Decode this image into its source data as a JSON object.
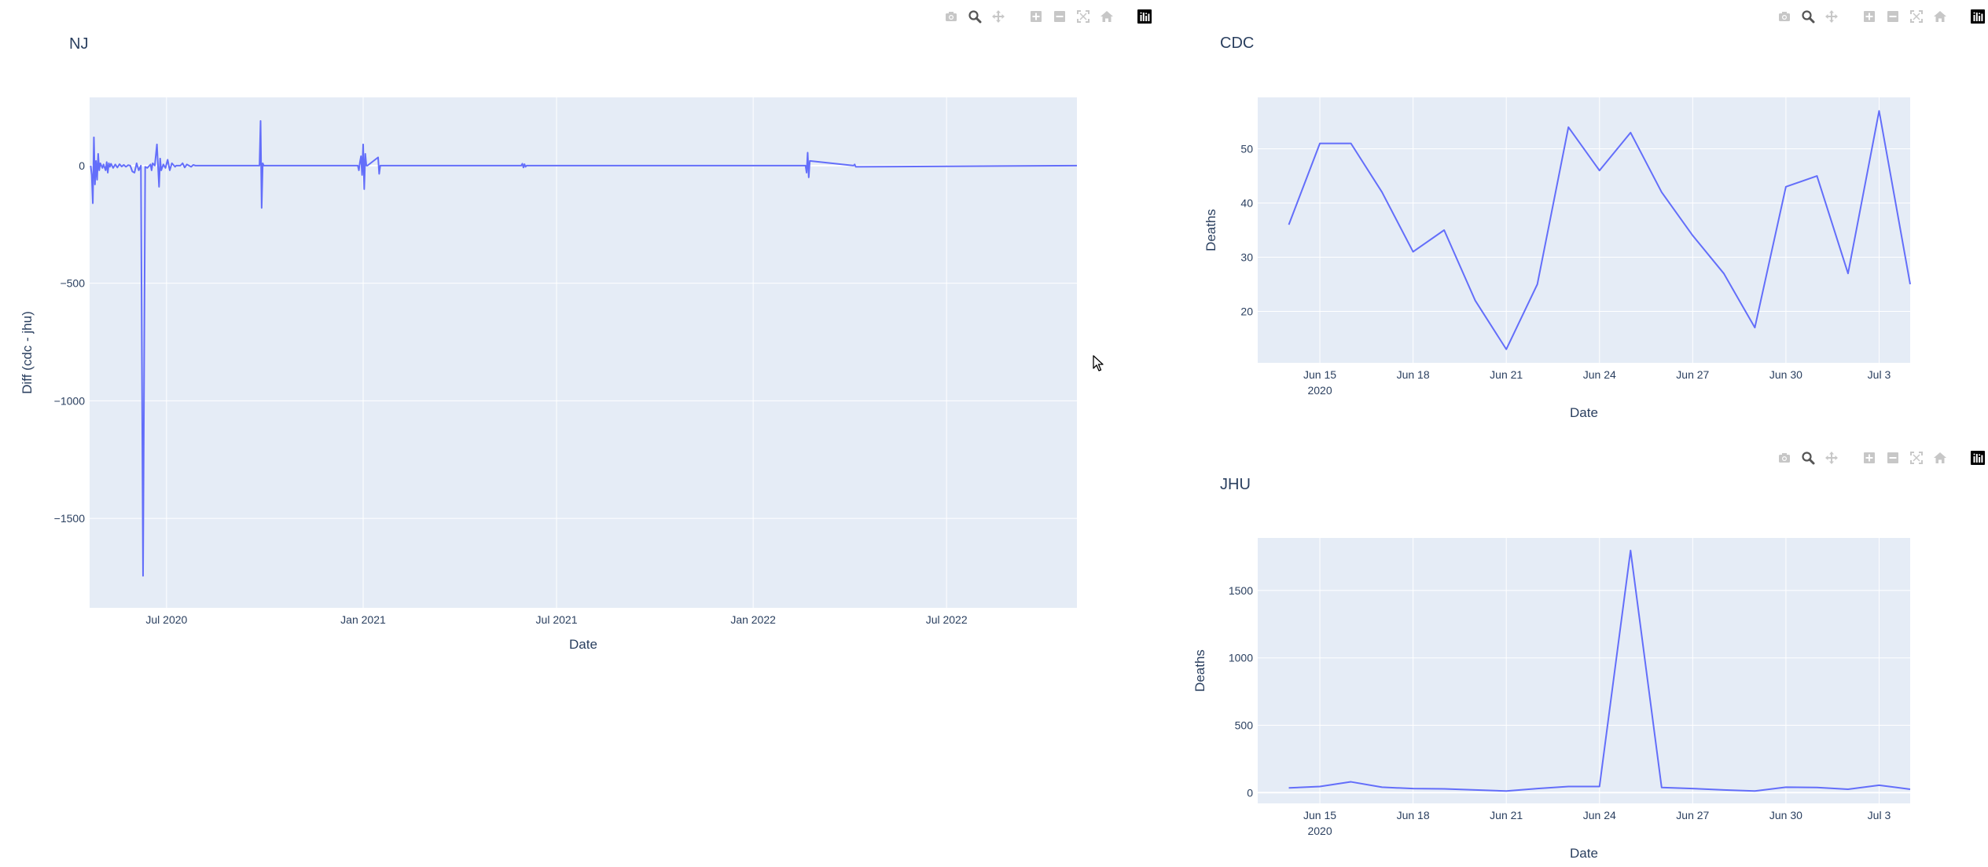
{
  "colors": {
    "plot_bg": "#e5ecf6",
    "grid": "#ffffff",
    "line": "#636efa",
    "text": "#2a3f5f",
    "modebar_icon": "#c7c7c7",
    "modebar_active": "#555555",
    "plotly_logo_bg": "#000000"
  },
  "modebar": {
    "icons": [
      "camera-icon",
      "zoom-icon",
      "pan-icon",
      "zoom-in-icon",
      "zoom-out-icon",
      "autoscale-icon",
      "reset-axes-icon",
      "plotly-logo-icon"
    ]
  },
  "chart_data": [
    {
      "id": "nj",
      "type": "line",
      "title": "NJ",
      "xlabel": "Date",
      "ylabel": "Diff (cdc - jhu)",
      "x_range": [
        "2020-04-20",
        "2022-10-31"
      ],
      "ylim": [
        -1880,
        290
      ],
      "y_ticks": [
        0,
        -500,
        -1000,
        -1500
      ],
      "y_tick_labels": [
        "0",
        "−500",
        "−1000",
        "−1500"
      ],
      "x_ticks": [
        "2020-07-01",
        "2021-01-01",
        "2021-07-01",
        "2022-01-01",
        "2022-07-01"
      ],
      "x_tick_labels": [
        "Jul 2020",
        "Jan 2021",
        "Jul 2021",
        "Jan 2022",
        "Jul 2022"
      ],
      "series": [
        {
          "x": [
            "2020-04-21",
            "2020-04-22",
            "2020-04-23",
            "2020-04-24",
            "2020-04-25",
            "2020-04-26",
            "2020-04-27",
            "2020-04-28",
            "2020-04-29",
            "2020-04-30",
            "2020-05-01",
            "2020-05-02",
            "2020-05-03",
            "2020-05-05",
            "2020-05-06",
            "2020-05-07",
            "2020-05-08",
            "2020-05-09",
            "2020-05-10",
            "2020-05-12",
            "2020-05-14",
            "2020-05-16",
            "2020-05-18",
            "2020-05-20",
            "2020-05-22",
            "2020-05-24",
            "2020-05-26",
            "2020-05-28",
            "2020-05-30",
            "2020-06-01",
            "2020-06-03",
            "2020-06-05",
            "2020-06-07",
            "2020-06-09",
            "2020-06-11",
            "2020-06-13",
            "2020-06-15",
            "2020-06-16",
            "2020-06-17",
            "2020-06-18",
            "2020-06-20",
            "2020-06-22",
            "2020-06-24",
            "2020-06-25",
            "2020-06-26",
            "2020-06-28",
            "2020-06-30",
            "2020-07-02",
            "2020-07-04",
            "2020-07-06",
            "2020-07-08",
            "2020-07-09",
            "2020-07-10",
            "2020-07-11",
            "2020-07-12",
            "2020-07-14",
            "2020-07-16",
            "2020-07-18",
            "2020-07-20",
            "2020-07-22",
            "2020-07-24",
            "2020-07-26",
            "2020-07-28",
            "2020-08-05",
            "2020-08-07",
            "2020-08-09",
            "2020-08-11",
            "2020-08-13",
            "2020-08-15",
            "2020-08-17",
            "2020-08-19",
            "2020-08-21",
            "2020-08-23",
            "2020-08-25",
            "2020-09-26",
            "2020-09-27",
            "2020-09-28",
            "2020-09-29",
            "2020-09-30",
            "2020-10-01",
            "2020-12-25",
            "2020-12-26",
            "2020-12-27",
            "2020-12-28",
            "2020-12-29",
            "2020-12-30",
            "2020-12-31",
            "2021-01-01",
            "2021-01-02",
            "2021-01-03",
            "2021-01-04",
            "2021-01-05",
            "2021-01-15",
            "2021-01-16",
            "2021-01-17",
            "2021-01-18",
            "2021-05-29",
            "2021-05-30",
            "2021-05-31",
            "2021-06-01",
            "2021-06-02",
            "2021-06-03",
            "2022-02-18",
            "2022-02-19",
            "2022-02-20",
            "2022-02-21",
            "2022-02-22",
            "2022-02-23",
            "2022-04-05",
            "2022-04-06",
            "2022-04-07",
            "2022-10-31"
          ],
          "y": [
            0,
            -40,
            -160,
            120,
            -80,
            20,
            -60,
            50,
            -20,
            10,
            0,
            -10,
            5,
            -20,
            15,
            -30,
            10,
            -5,
            8,
            -10,
            5,
            -8,
            6,
            -4,
            3,
            -5,
            2,
            0,
            -25,
            -30,
            10,
            -20,
            0,
            -1744,
            -5,
            -10,
            0,
            5,
            -20,
            10,
            0,
            90,
            -90,
            30,
            -20,
            5,
            -10,
            25,
            -20,
            10,
            0,
            -5,
            0,
            0,
            0,
            0,
            10,
            -8,
            5,
            0,
            -5,
            3,
            0,
            0,
            0,
            0,
            0,
            0,
            0,
            0,
            0,
            0,
            0,
            0,
            0,
            190,
            -180,
            10,
            0,
            0,
            0,
            0,
            0,
            -20,
            15,
            40,
            -40,
            90,
            -100,
            50,
            0,
            0,
            35,
            -35,
            0,
            0,
            0,
            8,
            -8,
            6,
            -5,
            0,
            0,
            0,
            -30,
            55,
            -50,
            20,
            0,
            5,
            -5,
            0
          ]
        }
      ]
    },
    {
      "id": "cdc",
      "type": "line",
      "title": "CDC",
      "xlabel": "Date",
      "ylabel": "Deaths",
      "x_range": [
        "2020-06-13",
        "2020-07-04"
      ],
      "ylim": [
        10.5,
        59.5
      ],
      "y_ticks": [
        20,
        30,
        40,
        50
      ],
      "y_tick_labels": [
        "20",
        "30",
        "40",
        "50"
      ],
      "x_ticks": [
        "2020-06-15",
        "2020-06-18",
        "2020-06-21",
        "2020-06-24",
        "2020-06-27",
        "2020-06-30",
        "2020-07-03"
      ],
      "x_tick_labels": [
        "Jun 15",
        "Jun 18",
        "Jun 21",
        "Jun 24",
        "Jun 27",
        "Jun 30",
        "Jul 3"
      ],
      "x_tick_sublabel": "2020",
      "series": [
        {
          "x": [
            "2020-06-14",
            "2020-06-15",
            "2020-06-16",
            "2020-06-17",
            "2020-06-18",
            "2020-06-19",
            "2020-06-20",
            "2020-06-21",
            "2020-06-22",
            "2020-06-23",
            "2020-06-24",
            "2020-06-25",
            "2020-06-26",
            "2020-06-27",
            "2020-06-28",
            "2020-06-29",
            "2020-06-30",
            "2020-07-01",
            "2020-07-02",
            "2020-07-03",
            "2020-07-04"
          ],
          "y": [
            36,
            51,
            51,
            42,
            31,
            35,
            22,
            13,
            25,
            54,
            46,
            53,
            42,
            34,
            27,
            17,
            43,
            45,
            27,
            57,
            25
          ]
        }
      ]
    },
    {
      "id": "jhu",
      "type": "line",
      "title": "JHU",
      "xlabel": "Date",
      "ylabel": "Deaths",
      "x_range": [
        "2020-06-13",
        "2020-07-04"
      ],
      "ylim": [
        -80,
        1890
      ],
      "y_ticks": [
        0,
        500,
        1000,
        1500
      ],
      "y_tick_labels": [
        "0",
        "500",
        "1000",
        "1500"
      ],
      "x_ticks": [
        "2020-06-15",
        "2020-06-18",
        "2020-06-21",
        "2020-06-24",
        "2020-06-27",
        "2020-06-30",
        "2020-07-03"
      ],
      "x_tick_labels": [
        "Jun 15",
        "Jun 18",
        "Jun 21",
        "Jun 24",
        "Jun 27",
        "Jun 30",
        "Jul 3"
      ],
      "x_tick_sublabel": "2020",
      "series": [
        {
          "x": [
            "2020-06-14",
            "2020-06-15",
            "2020-06-16",
            "2020-06-17",
            "2020-06-18",
            "2020-06-19",
            "2020-06-20",
            "2020-06-21",
            "2020-06-22",
            "2020-06-23",
            "2020-06-24",
            "2020-06-25",
            "2020-06-26",
            "2020-06-27",
            "2020-06-28",
            "2020-06-29",
            "2020-06-30",
            "2020-07-01",
            "2020-07-02",
            "2020-07-03",
            "2020-07-04"
          ],
          "y": [
            35,
            45,
            80,
            40,
            30,
            28,
            20,
            12,
            30,
            45,
            45,
            1797,
            38,
            30,
            20,
            12,
            40,
            38,
            25,
            55,
            25
          ]
        }
      ]
    }
  ]
}
